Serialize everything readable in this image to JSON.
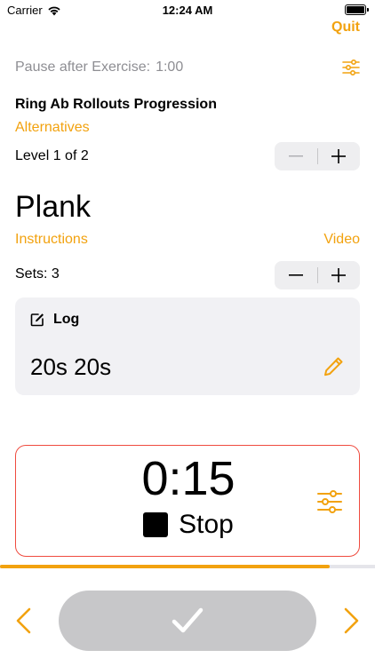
{
  "status_bar": {
    "carrier": "Carrier",
    "time": "12:24 AM"
  },
  "header": {
    "quit_label": "Quit"
  },
  "pause": {
    "label": "Pause after Exercise:",
    "value": "1:00"
  },
  "progression": {
    "title": "Ring Ab Rollouts Progression",
    "alternatives_label": "Alternatives",
    "level_label": "Level 1 of 2",
    "level_stepper": {
      "minus": "−",
      "plus": "+"
    }
  },
  "exercise": {
    "name": "Plank",
    "instructions_label": "Instructions",
    "video_label": "Video",
    "sets_label": "Sets: 3",
    "sets_stepper": {
      "minus": "−",
      "plus": "+"
    }
  },
  "log": {
    "title": "Log",
    "value": "20s 20s",
    "icon": "pencil-icon"
  },
  "timer": {
    "value": "0:15",
    "stop_label": "Stop"
  },
  "progress": {
    "fraction": 0.88
  },
  "colors": {
    "accent": "#f2a20f",
    "timer_border": "#ef4b3f",
    "secondary_text": "#8e8e93",
    "done_button": "#c7c7c9",
    "card_background": "#f1f1f4"
  }
}
